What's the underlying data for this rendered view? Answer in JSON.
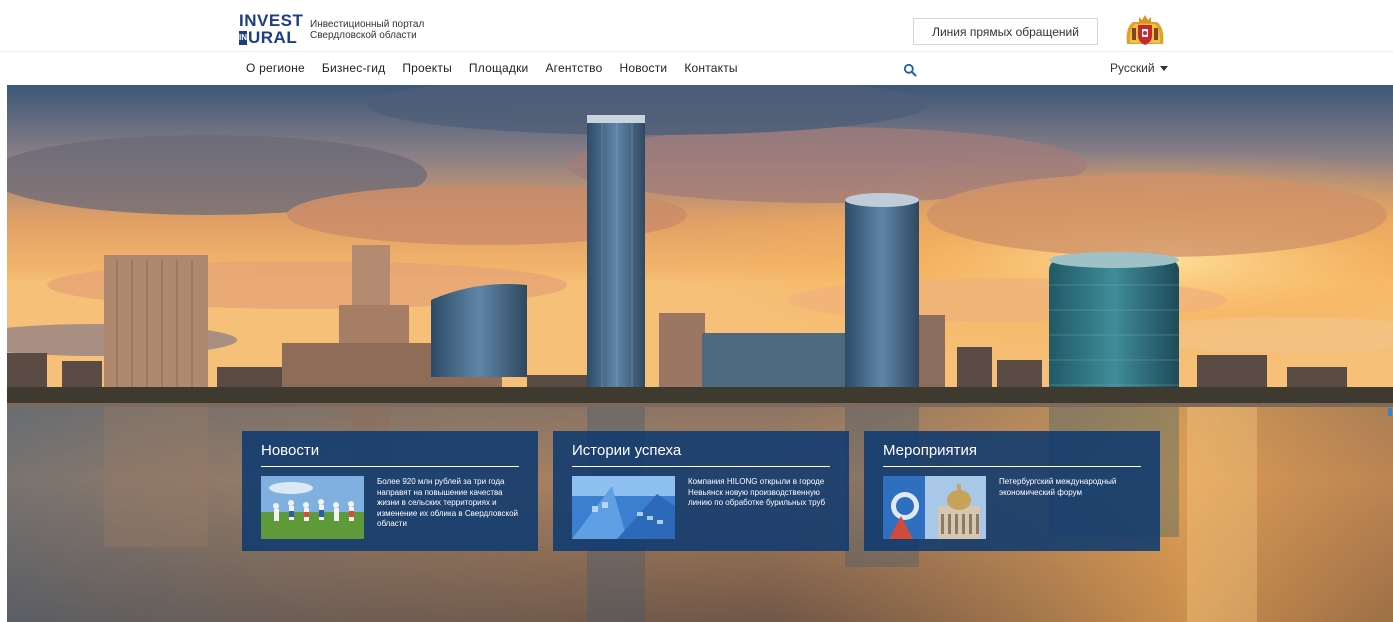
{
  "header": {
    "logo": {
      "line1": "INVEST",
      "in_badge": "IN",
      "line2": "URAL"
    },
    "portal_caption": {
      "line1": "Инвестиционный портал",
      "line2": "Свердловской области"
    },
    "hotline_label": "Линия прямых обращений",
    "coat_of_arms_icon": "coat-of-arms-icon"
  },
  "nav": {
    "items": [
      {
        "label": "О регионе"
      },
      {
        "label": "Бизнес-гид"
      },
      {
        "label": "Проекты"
      },
      {
        "label": "Площадки"
      },
      {
        "label": "Агентство"
      },
      {
        "label": "Новости"
      },
      {
        "label": "Контакты"
      }
    ],
    "search_icon": "search-icon",
    "language": "Русский"
  },
  "cards": [
    {
      "title": "Новости",
      "text": "Более 920 млн рублей за три года направят на повышение качества жизни в сельских территориях и изменение их облика в Свердловской области"
    },
    {
      "title": "Истории успеха",
      "text": "Компания HILONG открыли в городе Невьянск новую производственную линию по обработке бурильных труб"
    },
    {
      "title": "Мероприятия",
      "text": "Петербургский международный экономический форум"
    }
  ],
  "colors": {
    "brand_blue": "#1d3e86",
    "card_background": "#0f3a70",
    "slider_dot": "#2a86d6"
  }
}
